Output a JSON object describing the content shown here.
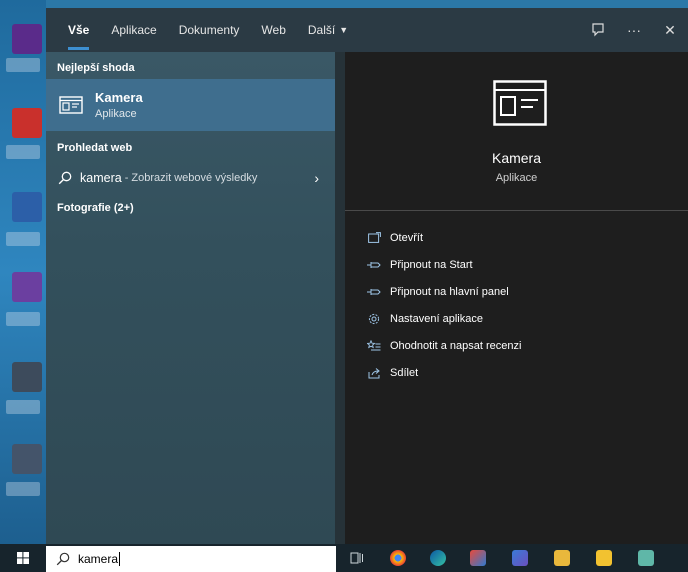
{
  "tabs": [
    {
      "label": "Vše",
      "active": true
    },
    {
      "label": "Aplikace"
    },
    {
      "label": "Dokumenty"
    },
    {
      "label": "Web"
    },
    {
      "label": "Další"
    }
  ],
  "top_actions": {
    "feedback_icon": "feedback-icon",
    "more_label": "···",
    "close_label": "✕"
  },
  "results": {
    "best_match_heading": "Nejlepší shoda",
    "best_match": {
      "title": "Kamera",
      "subtitle": "Aplikace"
    },
    "web_heading": "Prohledat web",
    "web_item": {
      "query": "kamera",
      "hint": "- Zobrazit webové výsledky"
    },
    "photos_heading": "Fotografie (2+)"
  },
  "detail": {
    "title": "Kamera",
    "subtitle": "Aplikace",
    "actions": [
      {
        "label": "Otevřít",
        "icon": "open-icon"
      },
      {
        "label": "Připnout na Start",
        "icon": "pin-icon"
      },
      {
        "label": "Připnout na hlavní panel",
        "icon": "pin-icon"
      },
      {
        "label": "Nastavení aplikace",
        "icon": "gear-icon"
      },
      {
        "label": "Ohodnotit a napsat recenzi",
        "icon": "star-list-icon"
      },
      {
        "label": "Sdílet",
        "icon": "share-icon"
      }
    ]
  },
  "taskbar": {
    "search_value": "kamera"
  },
  "colors": {
    "accent": "#3d8fd1",
    "selected_row": "#3f6e8e",
    "detail_bg": "#1e1e1e"
  }
}
